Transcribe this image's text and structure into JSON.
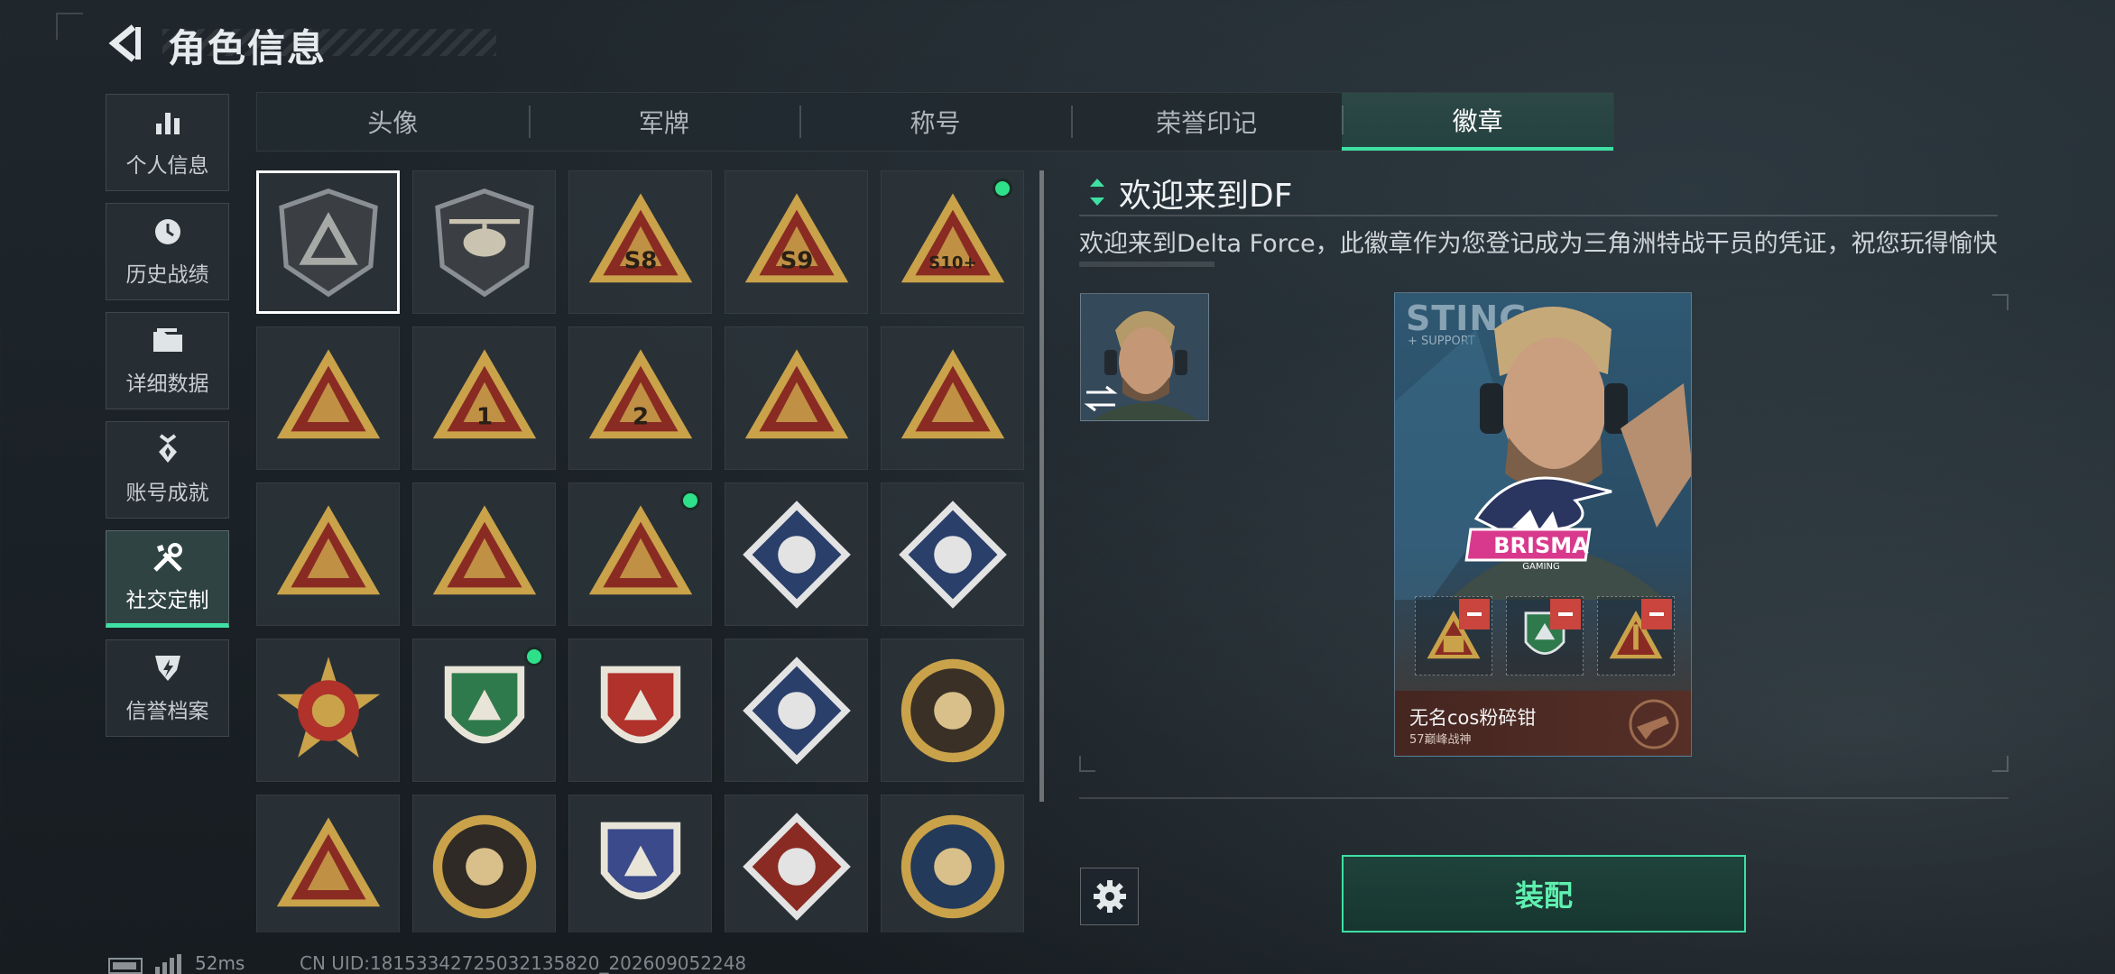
{
  "header": {
    "title": "角色信息",
    "back_icon": "back-arrow-icon"
  },
  "nav": {
    "items": [
      {
        "label": "个人信息",
        "icon": "bar-chart-icon",
        "active": false
      },
      {
        "label": "历史战绩",
        "icon": "history-clock-icon",
        "active": false
      },
      {
        "label": "详细数据",
        "icon": "folder-icon",
        "active": false
      },
      {
        "label": "账号成就",
        "icon": "achievement-medal-icon",
        "active": false
      },
      {
        "label": "社交定制",
        "icon": "tools-icon",
        "active": true
      },
      {
        "label": "信誉档案",
        "icon": "credit-shield-icon",
        "active": false
      }
    ]
  },
  "tabs": [
    {
      "label": "头像",
      "active": false
    },
    {
      "label": "军牌",
      "active": false
    },
    {
      "label": "称号",
      "active": false
    },
    {
      "label": "荣誉印记",
      "active": false
    },
    {
      "label": "徽章",
      "active": true
    }
  ],
  "badges": [
    {
      "icon": "triangle-shield-badge",
      "selected": true,
      "new": false,
      "text": ""
    },
    {
      "icon": "helicopter-shield-badge",
      "selected": false,
      "new": false,
      "text": ""
    },
    {
      "icon": "season-s8-badge",
      "selected": false,
      "new": false,
      "text": "S8"
    },
    {
      "icon": "season-s9-badge",
      "selected": false,
      "new": false,
      "text": "S9"
    },
    {
      "icon": "season-s10-badge",
      "selected": false,
      "new": true,
      "text": "S10+"
    },
    {
      "icon": "phoenix-triangle-badge",
      "selected": false,
      "new": false,
      "text": ""
    },
    {
      "icon": "number-one-badge",
      "selected": false,
      "new": false,
      "text": "1"
    },
    {
      "icon": "number-two-badge",
      "selected": false,
      "new": false,
      "text": "2"
    },
    {
      "icon": "delta-force-2025-badge",
      "selected": false,
      "new": false,
      "text": ""
    },
    {
      "icon": "delta-force-2026-badge",
      "selected": false,
      "new": false,
      "text": ""
    },
    {
      "icon": "gear-triangle-badge",
      "selected": false,
      "new": false,
      "text": ""
    },
    {
      "icon": "soldiers-triangle-badge",
      "selected": false,
      "new": false,
      "text": ""
    },
    {
      "icon": "rocket-triangle-badge",
      "selected": false,
      "new": true,
      "text": ""
    },
    {
      "icon": "rose-diamond-badge",
      "selected": false,
      "new": false,
      "text": ""
    },
    {
      "icon": "tank-diamond-badge",
      "selected": false,
      "new": false,
      "text": ""
    },
    {
      "icon": "star-medal-badge",
      "selected": false,
      "new": false,
      "text": ""
    },
    {
      "icon": "green-shield-badge",
      "selected": false,
      "new": true,
      "text": ""
    },
    {
      "icon": "red-wreath-shield-badge",
      "selected": false,
      "new": false,
      "text": ""
    },
    {
      "icon": "blue-diamond-shield-badge",
      "selected": false,
      "new": false,
      "text": ""
    },
    {
      "icon": "skull-round-badge",
      "selected": false,
      "new": false,
      "text": ""
    },
    {
      "icon": "rifle-crosshair-blue-badge",
      "selected": false,
      "new": false,
      "text": ""
    },
    {
      "icon": "smg-round-badge",
      "selected": false,
      "new": false,
      "text": ""
    },
    {
      "icon": "crosshair-gold-shield-badge",
      "selected": false,
      "new": false,
      "text": ""
    },
    {
      "icon": "wolf-diamond-badge",
      "selected": false,
      "new": false,
      "text": ""
    },
    {
      "icon": "eagle-round-badge",
      "selected": false,
      "new": false,
      "text": ""
    }
  ],
  "detail": {
    "title": "欢迎来到DF",
    "description": "欢迎来到Delta Force，此徽章作为您登记成为三角洲特战干员的凭证，祝您玩得愉快",
    "card": {
      "bg_text": "STING",
      "bg_sub": "+ SUPPORT",
      "player_name": "无名cos粉碎钳",
      "player_sub": "57巅峰战神",
      "logo_text": "BRISMA",
      "logo_sub": "GAMING"
    }
  },
  "actions": {
    "equip_label": "装配",
    "settings_icon": "gear-icon"
  },
  "status": {
    "ping": "52ms",
    "uid": "CN UID:1815334272503213582​0_202609052248"
  },
  "colors": {
    "accent": "#3ee0a3",
    "new_dot": "#2fe08a",
    "gold": "#c9a24a",
    "badge_red": "#8a2b23",
    "remove": "#c9453d"
  }
}
